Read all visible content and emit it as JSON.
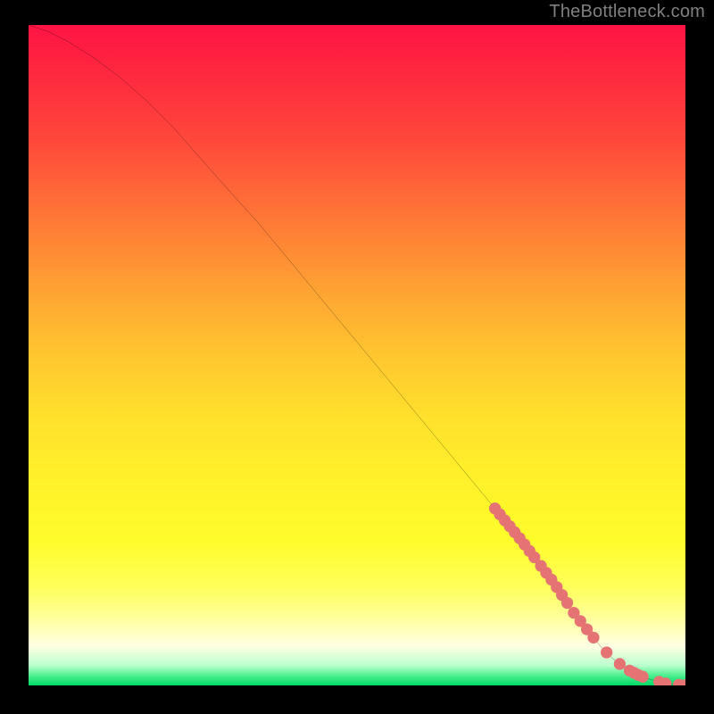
{
  "watermark": "TheBottleneck.com",
  "chart_data": {
    "type": "line",
    "title": "",
    "xlabel": "",
    "ylabel": "",
    "xlim": [
      0,
      100
    ],
    "ylim": [
      0,
      100
    ],
    "series": [
      {
        "name": "curve",
        "x": [
          0,
          3,
          6,
          10,
          14,
          18,
          22,
          26,
          30,
          35,
          40,
          45,
          50,
          55,
          60,
          65,
          70,
          75,
          80,
          83,
          85,
          87,
          89,
          91,
          93,
          95,
          97,
          99,
          100
        ],
        "y": [
          100,
          99,
          97.5,
          95,
          92,
          88.5,
          84.5,
          80,
          75.5,
          70,
          64,
          58,
          52,
          46,
          40,
          34,
          28,
          22,
          15.5,
          11,
          8.5,
          6,
          4,
          2.5,
          1.5,
          0.8,
          0.3,
          0.1,
          0.05
        ]
      }
    ],
    "marker_clusters": [
      {
        "x_range": [
          71,
          77
        ],
        "count": 9
      },
      {
        "x_range": [
          78,
          82
        ],
        "count": 6
      },
      {
        "x_range": [
          83,
          86
        ],
        "count": 4
      },
      {
        "x_range": [
          88,
          90
        ],
        "count": 2
      },
      {
        "x_range": [
          91.5,
          93.5
        ],
        "count": 4
      },
      {
        "x_range": [
          96,
          97
        ],
        "count": 2
      },
      {
        "x_range": [
          99,
          100
        ],
        "count": 2
      }
    ],
    "gradient_palette": {
      "top": "#ff1444",
      "mid": "#ffe22c",
      "bottom": "#00d966"
    }
  }
}
